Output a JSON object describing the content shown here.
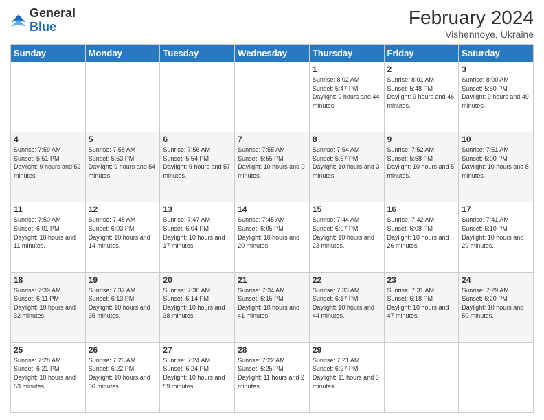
{
  "header": {
    "logo_general": "General",
    "logo_blue": "Blue",
    "month_year": "February 2024",
    "location": "Vishennoye, Ukraine"
  },
  "days_of_week": [
    "Sunday",
    "Monday",
    "Tuesday",
    "Wednesday",
    "Thursday",
    "Friday",
    "Saturday"
  ],
  "weeks": [
    [
      {
        "day": "",
        "info": ""
      },
      {
        "day": "",
        "info": ""
      },
      {
        "day": "",
        "info": ""
      },
      {
        "day": "",
        "info": ""
      },
      {
        "day": "1",
        "info": "Sunrise: 8:02 AM\nSunset: 5:47 PM\nDaylight: 9 hours and 44 minutes."
      },
      {
        "day": "2",
        "info": "Sunrise: 8:01 AM\nSunset: 5:48 PM\nDaylight: 9 hours and 46 minutes."
      },
      {
        "day": "3",
        "info": "Sunrise: 8:00 AM\nSunset: 5:50 PM\nDaylight: 9 hours and 49 minutes."
      }
    ],
    [
      {
        "day": "4",
        "info": "Sunrise: 7:59 AM\nSunset: 5:51 PM\nDaylight: 9 hours and 52 minutes."
      },
      {
        "day": "5",
        "info": "Sunrise: 7:58 AM\nSunset: 5:53 PM\nDaylight: 9 hours and 54 minutes."
      },
      {
        "day": "6",
        "info": "Sunrise: 7:56 AM\nSunset: 5:54 PM\nDaylight: 9 hours and 57 minutes."
      },
      {
        "day": "7",
        "info": "Sunrise: 7:55 AM\nSunset: 5:55 PM\nDaylight: 10 hours and 0 minutes."
      },
      {
        "day": "8",
        "info": "Sunrise: 7:54 AM\nSunset: 5:57 PM\nDaylight: 10 hours and 3 minutes."
      },
      {
        "day": "9",
        "info": "Sunrise: 7:52 AM\nSunset: 5:58 PM\nDaylight: 10 hours and 5 minutes."
      },
      {
        "day": "10",
        "info": "Sunrise: 7:51 AM\nSunset: 6:00 PM\nDaylight: 10 hours and 8 minutes."
      }
    ],
    [
      {
        "day": "11",
        "info": "Sunrise: 7:50 AM\nSunset: 6:01 PM\nDaylight: 10 hours and 11 minutes."
      },
      {
        "day": "12",
        "info": "Sunrise: 7:48 AM\nSunset: 6:03 PM\nDaylight: 10 hours and 14 minutes."
      },
      {
        "day": "13",
        "info": "Sunrise: 7:47 AM\nSunset: 6:04 PM\nDaylight: 10 hours and 17 minutes."
      },
      {
        "day": "14",
        "info": "Sunrise: 7:45 AM\nSunset: 6:05 PM\nDaylight: 10 hours and 20 minutes."
      },
      {
        "day": "15",
        "info": "Sunrise: 7:44 AM\nSunset: 6:07 PM\nDaylight: 10 hours and 23 minutes."
      },
      {
        "day": "16",
        "info": "Sunrise: 7:42 AM\nSunset: 6:08 PM\nDaylight: 10 hours and 26 minutes."
      },
      {
        "day": "17",
        "info": "Sunrise: 7:41 AM\nSunset: 6:10 PM\nDaylight: 10 hours and 29 minutes."
      }
    ],
    [
      {
        "day": "18",
        "info": "Sunrise: 7:39 AM\nSunset: 6:11 PM\nDaylight: 10 hours and 32 minutes."
      },
      {
        "day": "19",
        "info": "Sunrise: 7:37 AM\nSunset: 6:13 PM\nDaylight: 10 hours and 35 minutes."
      },
      {
        "day": "20",
        "info": "Sunrise: 7:36 AM\nSunset: 6:14 PM\nDaylight: 10 hours and 38 minutes."
      },
      {
        "day": "21",
        "info": "Sunrise: 7:34 AM\nSunset: 6:15 PM\nDaylight: 10 hours and 41 minutes."
      },
      {
        "day": "22",
        "info": "Sunrise: 7:33 AM\nSunset: 6:17 PM\nDaylight: 10 hours and 44 minutes."
      },
      {
        "day": "23",
        "info": "Sunrise: 7:31 AM\nSunset: 6:18 PM\nDaylight: 10 hours and 47 minutes."
      },
      {
        "day": "24",
        "info": "Sunrise: 7:29 AM\nSunset: 6:20 PM\nDaylight: 10 hours and 50 minutes."
      }
    ],
    [
      {
        "day": "25",
        "info": "Sunrise: 7:28 AM\nSunset: 6:21 PM\nDaylight: 10 hours and 53 minutes."
      },
      {
        "day": "26",
        "info": "Sunrise: 7:26 AM\nSunset: 6:22 PM\nDaylight: 10 hours and 56 minutes."
      },
      {
        "day": "27",
        "info": "Sunrise: 7:24 AM\nSunset: 6:24 PM\nDaylight: 10 hours and 59 minutes."
      },
      {
        "day": "28",
        "info": "Sunrise: 7:22 AM\nSunset: 6:25 PM\nDaylight: 11 hours and 2 minutes."
      },
      {
        "day": "29",
        "info": "Sunrise: 7:21 AM\nSunset: 6:27 PM\nDaylight: 11 hours and 5 minutes."
      },
      {
        "day": "",
        "info": ""
      },
      {
        "day": "",
        "info": ""
      }
    ]
  ]
}
